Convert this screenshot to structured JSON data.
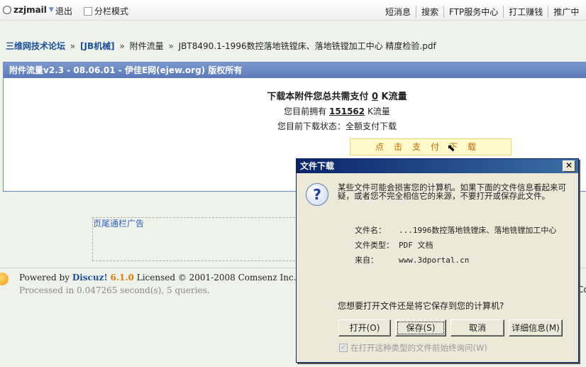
{
  "topbar": {
    "username": "zzjmail",
    "logout": "退出",
    "split_mode": "分栏模式",
    "nav": [
      "短消息",
      "搜索",
      "FTP服务中心",
      "打工赚钱",
      "推广中"
    ]
  },
  "breadcrumb": {
    "forum": "三维网技术论坛",
    "sep": "»",
    "board": "[JB机械]",
    "section": "附件流量",
    "file": "JBT8490.1-1996数控落地铣镗床、落地铣镗加工中心 精度检验.pdf"
  },
  "panel": {
    "header": "附件流量v2.3 - 08.06.01 - 伊佳E网(ejew.org) 版权所有",
    "line1_prefix": "下载本附件您总共需支付",
    "line1_value": "0",
    "line1_suffix": "K流量",
    "line2_prefix": "您目前拥有",
    "line2_value": "151562",
    "line2_suffix": "K流量",
    "line3": "您目前下载状态：全额支付下载",
    "pay_button": "点击支付下载"
  },
  "ad": {
    "label": "页尾通栏广告"
  },
  "footer": {
    "powered_by": "Powered by",
    "brand": "Discuz!",
    "version": "6.1.0",
    "license": "Licensed © 2001-2008 Comsenz Inc.",
    "processed": "Processed in 0.047265 second(s), 5 queries.",
    "right_clip": "Co"
  },
  "dialog": {
    "title": "文件下载",
    "close": "✕",
    "warning": "某些文件可能会损害您的计算机。如果下面的文件信息看起来可疑，或者您不完全相信它的来源，不要打开或保存此文件。",
    "filename_label": "文件名：",
    "filename_value": "...1996数控落地铣镗床、落地铣镗加工中心",
    "filetype_label": "文件类型：",
    "filetype_value": "PDF 文档",
    "from_label": "来自：",
    "from_value": "www.3dportal.cn",
    "question": "您想要打开文件还是将它保存到您的计算机?",
    "buttons": {
      "open": "打开(O)",
      "save": "保存(S)",
      "cancel": "取消",
      "details": "详细信息(M)"
    },
    "checkbox_label": "在打开这种类型的文件前始终询问(W)",
    "checkbox_checked": true
  }
}
